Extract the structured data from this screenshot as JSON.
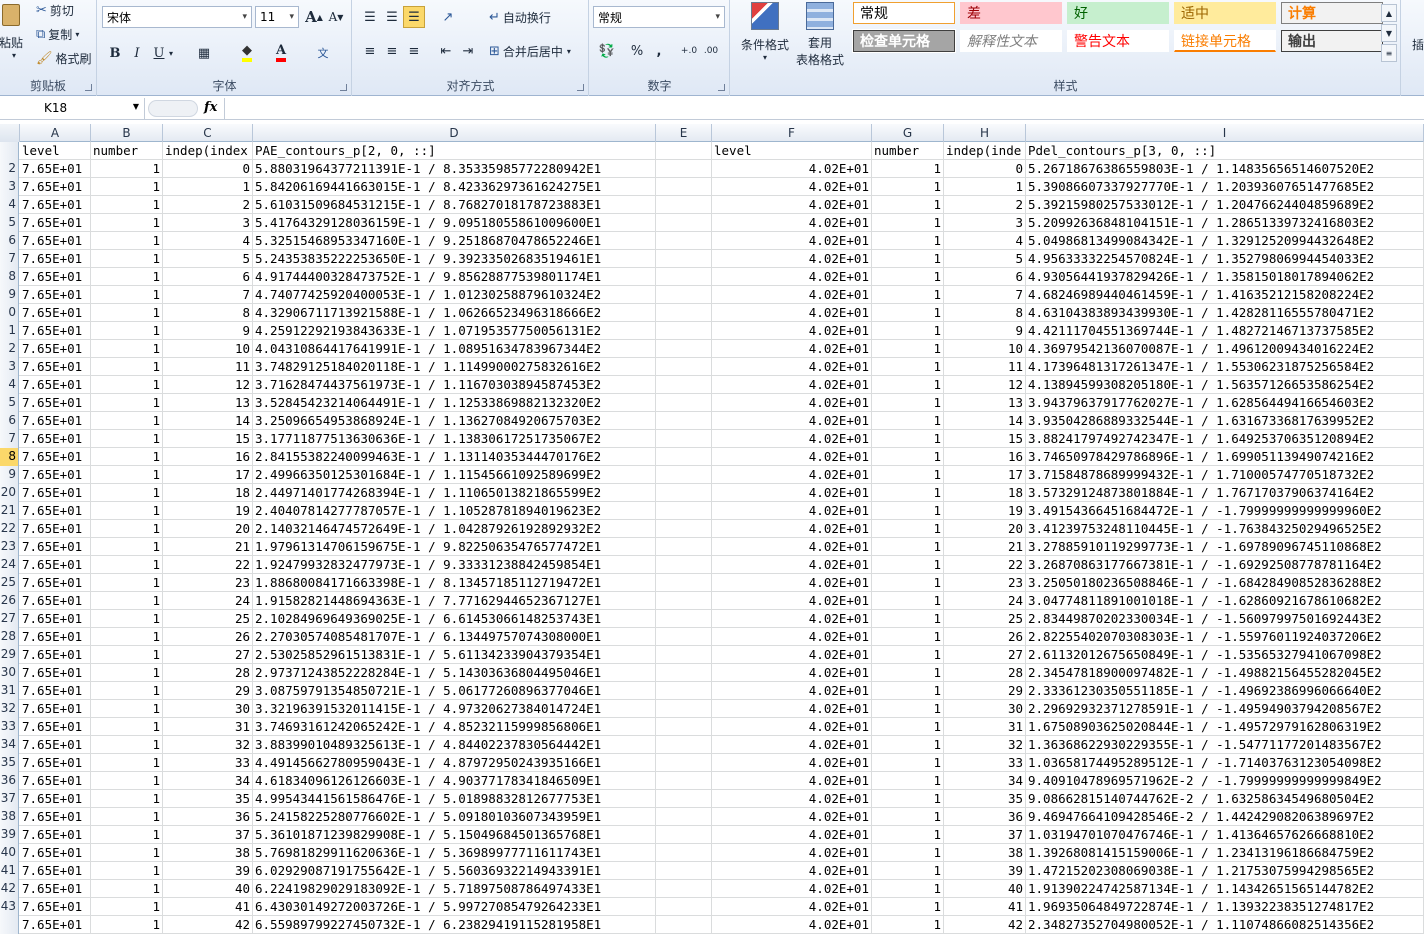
{
  "ribbon": {
    "clipboard": {
      "paste": "粘贴",
      "cut": "剪切",
      "copy": "复制",
      "format_painter": "格式刷",
      "group": "剪贴板"
    },
    "font": {
      "name": "宋体",
      "size": "11",
      "grow": "A",
      "shrink": "A",
      "bold": "B",
      "italic": "I",
      "underline": "U",
      "group": "字体"
    },
    "alignment": {
      "wrap": "自动换行",
      "merge": "合并后居中",
      "group": "对齐方式"
    },
    "number": {
      "format": "常规",
      "percent": "%",
      "comma": ",",
      "group": "数字"
    },
    "styles": {
      "conditional": "条件格式",
      "table_format": [
        "套用",
        "表格格式"
      ],
      "group": "样式",
      "cells": [
        {
          "label": "常规",
          "bg": "#ffffff",
          "fg": "#000000",
          "border": "#f0a030"
        },
        {
          "label": "差",
          "bg": "#ffc7ce",
          "fg": "#9c0006",
          "border": "#ffc7ce"
        },
        {
          "label": "好",
          "bg": "#c6efce",
          "fg": "#006100",
          "border": "#c6efce"
        },
        {
          "label": "适中",
          "bg": "#ffeb9c",
          "fg": "#9c6500",
          "border": "#ffeb9c"
        },
        {
          "label": "计算",
          "bg": "#f2f2f2",
          "fg": "#fa7d00",
          "border": "#7f7f7f"
        },
        {
          "label": "检查单元格",
          "bg": "#a5a5a5",
          "fg": "#ffffff",
          "border": "#3f3f3f"
        },
        {
          "label": "解释性文本",
          "bg": "#ffffff",
          "fg": "#7f7f7f",
          "border": "#ffffff"
        },
        {
          "label": "警告文本",
          "bg": "#ffffff",
          "fg": "#ff0000",
          "border": "#ffffff"
        },
        {
          "label": "链接单元格",
          "bg": "#ffffff",
          "fg": "#fa7d00",
          "border": "#ffffff"
        },
        {
          "label": "输出",
          "bg": "#f2f2f2",
          "fg": "#3f3f3f",
          "border": "#3f3f3f"
        }
      ]
    },
    "cells_partial": "插"
  },
  "formula_bar": {
    "name_box": "K18",
    "fx": "fx",
    "formula": ""
  },
  "columns": [
    "A",
    "B",
    "C",
    "D",
    "E",
    "F",
    "G",
    "H",
    "I"
  ],
  "header_row": {
    "A": "level",
    "B": "number",
    "C": "indep(index",
    "D": "PAE_contours_p[2, 0, ::]",
    "E": "",
    "F": "level",
    "G": "number",
    "H": "indep(inde",
    "I": "Pdel_contours_p[3, 0, ::]"
  },
  "row_numbers": [
    "1",
    "2",
    "3",
    "4",
    "5",
    "6",
    "7",
    "8",
    "9",
    "10",
    "11",
    "12",
    "13",
    "14",
    "15",
    "16",
    "17",
    "18",
    "19",
    "20",
    "21",
    "22",
    "23",
    "24",
    "25",
    "26",
    "27",
    "28",
    "29",
    "30",
    "31",
    "32",
    "33",
    "34",
    "35",
    "36",
    "37",
    "38",
    "39",
    "40",
    "41",
    "42",
    "43",
    "44"
  ],
  "row_labels_shown": [
    "",
    "2",
    "3",
    "4",
    "5",
    "6",
    "7",
    "8",
    "9",
    "0",
    "1",
    "2",
    "3",
    "4",
    "5",
    "6",
    "7",
    "8",
    "9",
    "20",
    "21",
    "22",
    "23",
    "24",
    "25",
    "26",
    "27",
    "28",
    "29",
    "30",
    "31",
    "32",
    "33",
    "34",
    "35",
    "36",
    "37",
    "38",
    "39",
    "40",
    "41",
    "42",
    "43",
    ""
  ],
  "selected_row": "18",
  "A_value": "7.65E+01",
  "B_value": "1",
  "F_value": "4.02E+01",
  "G_value": "1",
  "D_values": [
    "5.88031964377211391E-1 / 8.35335985772280942E1",
    "5.84206169441663015E-1 / 8.42336297361624275E1",
    "5.61031509684531215E-1 / 8.76827018178723883E1",
    "5.41764329128036159E-1 / 9.09518055861009600E1",
    "5.32515468953347160E-1 / 9.25186870478652246E1",
    "5.24353835222253650E-1 / 9.39233502683519461E1",
    "4.91744400328473752E-1 / 9.85628877539801174E1",
    "4.74077425920400053E-1 / 1.01230258879610324E2",
    "4.32906711713921588E-1 / 1.06266523496318666E2",
    "4.25912292193843633E-1 / 1.07195357750056131E2",
    "4.04310864417641991E-1 / 1.08951634783967344E2",
    "3.74829125184020118E-1 / 1.11499000275832616E2",
    "3.71628474437561973E-1 / 1.11670303894587453E2",
    "3.52845423214064491E-1 / 1.12533869882132320E2",
    "3.25096654953868924E-1 / 1.13627084920675703E2",
    "3.17711877513630636E-1 / 1.13830617251735067E2",
    "2.84155382240099463E-1 / 1.13114035344470176E2",
    "2.49966350125301684E-1 / 1.11545661092589699E2",
    "2.44971401774268394E-1 / 1.11065013821865599E2",
    "2.40407814277787057E-1 / 1.10528781894019623E2",
    "2.14032146474572649E-1 / 1.04287926192892932E2",
    "1.97961314706159675E-1 / 9.82250635476577472E1",
    "1.92479932832477973E-1 / 9.33331238842459854E1",
    "1.88680084171663398E-1 / 8.13457185112719472E1",
    "1.91582821448694363E-1 / 7.77162944652367127E1",
    "2.10284969649369025E-1 / 6.61453066148253743E1",
    "2.27030574085481707E-1 / 6.13449757074308000E1",
    "2.53025852961513831E-1 / 5.61134233904379354E1",
    "2.97371243852228284E-1 / 5.14303636804495046E1",
    "3.08759791354850721E-1 / 5.06177260896377046E1",
    "3.32196391532011415E-1 / 4.97320627384014724E1",
    "3.74693161242065242E-1 / 4.85232115999856806E1",
    "3.88399010489325613E-1 / 4.84402237830564442E1",
    "4.49145662780959043E-1 / 4.87972950243935166E1",
    "4.61834096126126603E-1 / 4.90377178341846509E1",
    "4.99543441561586476E-1 / 5.01898832812677753E1",
    "5.24158225280776602E-1 / 5.09180103607343959E1",
    "5.36101871239829908E-1 / 5.15049684501365768E1",
    "5.76981829911620636E-1 / 5.36989977711611743E1",
    "6.02929087191755642E-1 / 5.56036932214943391E1",
    "6.22419829029183092E-1 / 5.71897508786497433E1",
    "6.43030149272003726E-1 / 5.99727085479264233E1",
    "6.55989799227450732E-1 / 6.23829419115281958E1"
  ],
  "I_values": [
    "5.26718676386559803E-1 / 1.14835656514607520E2",
    "5.39086607337927770E-1 / 1.20393607651477685E2",
    "5.39215980257533012E-1 / 1.20476624404859689E2",
    "5.20992636848104151E-1 / 1.28651339732416803E2",
    "5.04986813499084342E-1 / 1.32912520994432648E2",
    "4.95633332254570824E-1 / 1.35279806994454033E2",
    "4.93056441937829426E-1 / 1.35815018017894062E2",
    "4.68246989440461459E-1 / 1.41635212158208224E2",
    "4.63104383893439930E-1 / 1.42828116555780471E2",
    "4.42111704551369744E-1 / 1.48272146713737585E2",
    "4.36979542136070087E-1 / 1.49612009434016224E2",
    "4.17396481317261347E-1 / 1.55306231875256584E2",
    "4.13894599308205180E-1 / 1.56357126653586254E2",
    "3.94379637917762027E-1 / 1.62856449416654603E2",
    "3.93504286889332544E-1 / 1.63167336817639952E2",
    "3.88241797492742347E-1 / 1.64925370635120894E2",
    "3.74650978429786896E-1 / 1.69905113949074216E2",
    "3.71584878689999432E-1 / 1.71000574770518732E2",
    "3.57329124873801884E-1 / 1.76717037906374164E2",
    "3.49154366451684472E-1 / -1.79999999999999960E2",
    "3.41239753248110445E-1 / -1.76384325029496525E2",
    "3.27885910119299773E-1 / -1.69789096745110868E2",
    "3.26870863177667381E-1 / -1.69292508778781164E2",
    "3.25050180236508846E-1 / -1.68428490852836288E2",
    "3.04774811891001018E-1 / -1.62860921678610682E2",
    "2.83449870202330034E-1 / -1.56097997501692443E2",
    "2.82255402070308303E-1 / -1.55976011924037206E2",
    "2.61132012675650849E-1 / -1.53565327941067098E2",
    "2.34547818900097482E-1 / -1.49882156455282045E2",
    "2.33361230350551185E-1 / -1.49692386996066640E2",
    "2.29692932371278591E-1 / -1.49594903794208567E2",
    "1.67508903625020844E-1 / -1.49572979162806319E2",
    "1.36368622930229355E-1 / -1.54771177201483567E2",
    "1.03658174495289512E-1 / -1.71403763123054098E2",
    "9.40910478969571962E-2 / -1.79999999999999849E2",
    "9.08662815140744762E-2 / 1.63258634549680504E2",
    "9.46947664109428546E-2 / 1.44242908206389697E2",
    "1.03194701070476746E-1 / 1.41364657626668810E2",
    "1.39268081415159006E-1 / 1.23413196186684759E2",
    "1.47215202308069038E-1 / 1.21753075994298565E2",
    "1.91390224742587134E-1 / 1.14342651565144782E2",
    "1.96935064849722874E-1 / 1.13932238351274817E2",
    "2.34827352704980052E-1 / 1.11074866082514356E2"
  ]
}
